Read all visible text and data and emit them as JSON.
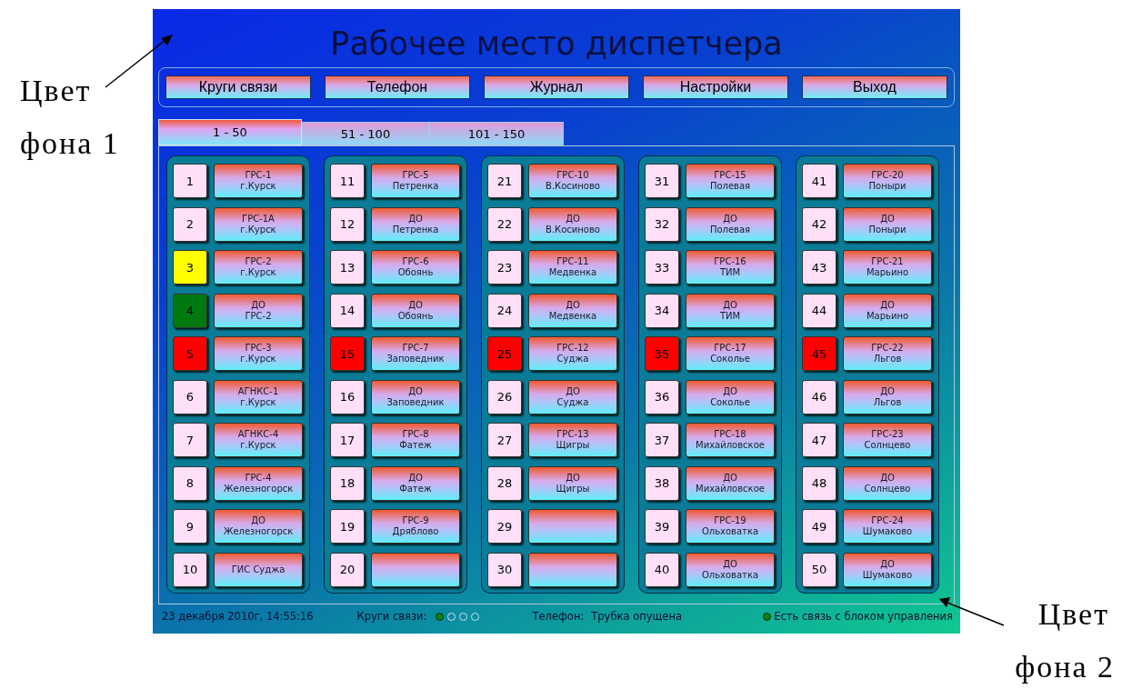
{
  "annotations": {
    "left": [
      "Цвет",
      "фона 1"
    ],
    "right": [
      "Цвет",
      "фона 2"
    ]
  },
  "window": {
    "title": "Рабочее место диспетчера"
  },
  "menu": [
    "Круги связи",
    "Телефон",
    "Журнал",
    "Настройки",
    "Выход"
  ],
  "tabs": [
    {
      "label": "1 - 50",
      "selected": true
    },
    {
      "label": "51 - 100",
      "selected": false
    },
    {
      "label": "101 - 150",
      "selected": false
    }
  ],
  "columns": [
    {
      "slots": [
        {
          "number": "1",
          "color": "#ffe0f8",
          "lines": [
            "ГРС-1",
            "г.Курск"
          ]
        },
        {
          "number": "2",
          "color": "#ffe0f8",
          "lines": [
            "ГРС-1А",
            "г.Курск"
          ]
        },
        {
          "number": "3",
          "color": "#ffff00",
          "lines": [
            "ГРС-2",
            "г.Курск"
          ]
        },
        {
          "number": "4",
          "color": "#007a10",
          "lines": [
            "ДО",
            "ГРС-2"
          ]
        },
        {
          "number": "5",
          "color": "#ff0000",
          "lines": [
            "ГРС-3",
            "г.Курск"
          ]
        },
        {
          "number": "6",
          "color": "#ffe0f8",
          "lines": [
            "АГНКС-1",
            "г.Курск"
          ]
        },
        {
          "number": "7",
          "color": "#ffe0f8",
          "lines": [
            "АГНКС-4",
            "г.Курск"
          ]
        },
        {
          "number": "8",
          "color": "#ffe0f8",
          "lines": [
            "ГРС-4",
            "Железногорск"
          ]
        },
        {
          "number": "9",
          "color": "#ffe0f8",
          "lines": [
            "ДО",
            "Железногорск"
          ]
        },
        {
          "number": "10",
          "color": "#ffe0f8",
          "lines": [
            "ГИС Суджа"
          ]
        }
      ]
    },
    {
      "slots": [
        {
          "number": "11",
          "color": "#ffe0f8",
          "lines": [
            "ГРС-5",
            "Петренка"
          ]
        },
        {
          "number": "12",
          "color": "#ffe0f8",
          "lines": [
            "ДО",
            "Петренка"
          ]
        },
        {
          "number": "13",
          "color": "#ffe0f8",
          "lines": [
            "ГРС-6",
            "Обоянь"
          ]
        },
        {
          "number": "14",
          "color": "#ffe0f8",
          "lines": [
            "ДО",
            "Обоянь"
          ]
        },
        {
          "number": "15",
          "color": "#ff0000",
          "lines": [
            "ГРС-7",
            "Заповедник"
          ]
        },
        {
          "number": "16",
          "color": "#ffe0f8",
          "lines": [
            "ДО",
            "Заповедник"
          ]
        },
        {
          "number": "17",
          "color": "#ffe0f8",
          "lines": [
            "ГРС-8",
            "Фатеж"
          ]
        },
        {
          "number": "18",
          "color": "#ffe0f8",
          "lines": [
            "ДО",
            "Фатеж"
          ]
        },
        {
          "number": "19",
          "color": "#ffe0f8",
          "lines": [
            "ГРС-9",
            "Дряблово"
          ]
        },
        {
          "number": "20",
          "color": "#ffe0f8"
        }
      ]
    },
    {
      "slots": [
        {
          "number": "21",
          "color": "#ffe0f8",
          "lines": [
            "ГРС-10",
            "В.Косиново"
          ]
        },
        {
          "number": "22",
          "color": "#ffe0f8",
          "lines": [
            "ДО",
            "В.Косиново"
          ]
        },
        {
          "number": "23",
          "color": "#ffe0f8",
          "lines": [
            "ГРС-11",
            "Медвенка"
          ]
        },
        {
          "number": "24",
          "color": "#ffe0f8",
          "lines": [
            "ДО",
            "Медвенка"
          ]
        },
        {
          "number": "25",
          "color": "#ff0000",
          "lines": [
            "ГРС-12",
            "Суджа"
          ]
        },
        {
          "number": "26",
          "color": "#ffe0f8",
          "lines": [
            "ДО",
            "Суджа"
          ]
        },
        {
          "number": "27",
          "color": "#ffe0f8",
          "lines": [
            "ГРС-13",
            "Щигры"
          ]
        },
        {
          "number": "28",
          "color": "#ffe0f8",
          "lines": [
            "ДО",
            "Щигры"
          ]
        },
        {
          "number": "29",
          "color": "#ffe0f8"
        },
        {
          "number": "30",
          "color": "#ffe0f8"
        }
      ]
    },
    {
      "slots": [
        {
          "number": "31",
          "color": "#ffe0f8",
          "lines": [
            "ГРС-15",
            "Полевая"
          ]
        },
        {
          "number": "32",
          "color": "#ffe0f8",
          "lines": [
            "ДО",
            "Полевая"
          ]
        },
        {
          "number": "33",
          "color": "#ffe0f8",
          "lines": [
            "ГРС-16",
            "ТИМ"
          ]
        },
        {
          "number": "34",
          "color": "#ffe0f8",
          "lines": [
            "ДО",
            "ТИМ"
          ]
        },
        {
          "number": "35",
          "color": "#ff0000",
          "lines": [
            "ГРС-17",
            "Соколье"
          ]
        },
        {
          "number": "36",
          "color": "#ffe0f8",
          "lines": [
            "ДО",
            "Соколье"
          ]
        },
        {
          "number": "37",
          "color": "#ffe0f8",
          "lines": [
            "ГРС-18",
            "Михайловское"
          ]
        },
        {
          "number": "38",
          "color": "#ffe0f8",
          "lines": [
            "ДО",
            "Михайловское"
          ]
        },
        {
          "number": "39",
          "color": "#ffe0f8",
          "lines": [
            "ГРС-19",
            "Ольховатка"
          ]
        },
        {
          "number": "40",
          "color": "#ffe0f8",
          "lines": [
            "ДО",
            "Ольховатка"
          ]
        }
      ]
    },
    {
      "slots": [
        {
          "number": "41",
          "color": "#ffe0f8",
          "lines": [
            "ГРС-20",
            "Поныри"
          ]
        },
        {
          "number": "42",
          "color": "#ffe0f8",
          "lines": [
            "ДО",
            "Поныри"
          ]
        },
        {
          "number": "43",
          "color": "#ffe0f8",
          "lines": [
            "ГРС-21",
            "Марьино"
          ]
        },
        {
          "number": "44",
          "color": "#ffe0f8",
          "lines": [
            "ДО",
            "Марьино"
          ]
        },
        {
          "number": "45",
          "color": "#ff0000",
          "lines": [
            "ГРС-22",
            "Льгов"
          ]
        },
        {
          "number": "46",
          "color": "#ffe0f8",
          "lines": [
            "ДО",
            "Льгов"
          ]
        },
        {
          "number": "47",
          "color": "#ffe0f8",
          "lines": [
            "ГРС-23",
            "Солнцево"
          ]
        },
        {
          "number": "48",
          "color": "#ffe0f8",
          "lines": [
            "ДО",
            "Солнцево"
          ]
        },
        {
          "number": "49",
          "color": "#ffe0f8",
          "lines": [
            "ГРС-24",
            "Шумаково"
          ]
        },
        {
          "number": "50",
          "color": "#ffe0f8",
          "lines": [
            "ДО",
            "Шумаково"
          ]
        }
      ]
    }
  ],
  "status_bar": {
    "datetime": "23 декабря 2010г, 14:55:16",
    "circles_label": "Круги связи:",
    "circles": [
      {
        "on": true
      },
      {
        "on": false
      },
      {
        "on": false
      },
      {
        "on": false
      }
    ],
    "phone_label": "Телефон:",
    "phone_status": "Трубка опущена",
    "connection": {
      "on": true,
      "text": "Есть связь с блоком управления"
    }
  }
}
